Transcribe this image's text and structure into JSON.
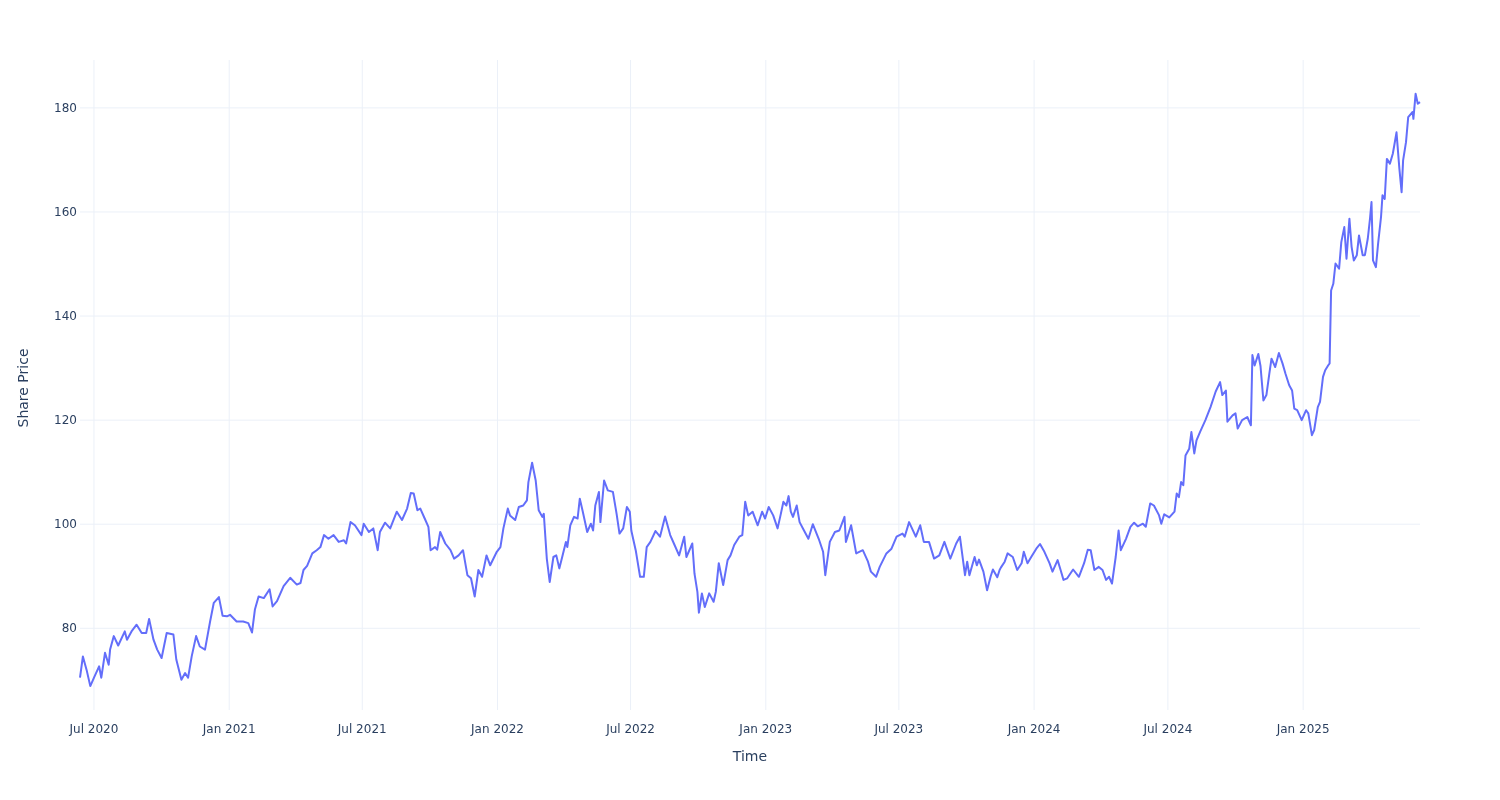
{
  "figure": {
    "chart_data": {
      "type": "line",
      "xlabel": "Time",
      "ylabel": "Share Price",
      "grid": true,
      "xlim": [
        "2020-06-12",
        "2025-06-09"
      ],
      "ylim": [
        64.3,
        189.2
      ],
      "xticks": [
        {
          "value": "2020-07-01",
          "label": "Jul 2020"
        },
        {
          "value": "2021-01-01",
          "label": "Jan 2021"
        },
        {
          "value": "2021-07-01",
          "label": "Jul 2021"
        },
        {
          "value": "2022-01-01",
          "label": "Jan 2022"
        },
        {
          "value": "2022-07-01",
          "label": "Jul 2022"
        },
        {
          "value": "2023-01-01",
          "label": "Jan 2023"
        },
        {
          "value": "2023-07-01",
          "label": "Jul 2023"
        },
        {
          "value": "2024-01-01",
          "label": "Jan 2024"
        },
        {
          "value": "2024-07-01",
          "label": "Jul 2024"
        },
        {
          "value": "2025-01-01",
          "label": "Jan 2025"
        }
      ],
      "yticks": [
        80,
        100,
        120,
        140,
        160,
        180
      ],
      "x": [
        "2020-06-12",
        "2020-06-16",
        "2020-06-21",
        "2020-06-26",
        "2020-07-01",
        "2020-07-08",
        "2020-07-11",
        "2020-07-16",
        "2020-07-21",
        "2020-07-23",
        "2020-07-28",
        "2020-08-03",
        "2020-08-12",
        "2020-08-15",
        "2020-08-21",
        "2020-08-28",
        "2020-09-04",
        "2020-09-10",
        "2020-09-14",
        "2020-09-20",
        "2020-09-25",
        "2020-10-01",
        "2020-10-08",
        "2020-10-17",
        "2020-10-21",
        "2020-10-28",
        "2020-11-02",
        "2020-11-06",
        "2020-11-11",
        "2020-11-17",
        "2020-11-22",
        "2020-11-29",
        "2020-12-06",
        "2020-12-11",
        "2020-12-18",
        "2020-12-23",
        "2020-12-29",
        "2021-01-02",
        "2021-01-11",
        "2021-01-20",
        "2021-01-27",
        "2021-02-01",
        "2021-02-05",
        "2021-02-10",
        "2021-02-17",
        "2021-02-25",
        "2021-03-01",
        "2021-03-07",
        "2021-03-16",
        "2021-03-25",
        "2021-04-03",
        "2021-04-08",
        "2021-04-12",
        "2021-04-17",
        "2021-04-24",
        "2021-04-30",
        "2021-05-05",
        "2021-05-10",
        "2021-05-16",
        "2021-05-23",
        "2021-05-30",
        "2021-06-06",
        "2021-06-09",
        "2021-06-15",
        "2021-06-21",
        "2021-06-30",
        "2021-07-03",
        "2021-07-10",
        "2021-07-16",
        "2021-07-22",
        "2021-07-25",
        "2021-08-01",
        "2021-08-08",
        "2021-08-17",
        "2021-08-24",
        "2021-08-31",
        "2021-09-05",
        "2021-09-09",
        "2021-09-14",
        "2021-09-18",
        "2021-09-24",
        "2021-09-29",
        "2021-10-02",
        "2021-10-08",
        "2021-10-11",
        "2021-10-15",
        "2021-10-22",
        "2021-10-29",
        "2021-11-03",
        "2021-11-09",
        "2021-11-15",
        "2021-11-21",
        "2021-11-26",
        "2021-12-01",
        "2021-12-06",
        "2021-12-11",
        "2021-12-17",
        "2021-12-22",
        "2021-12-31",
        "2022-01-05",
        "2022-01-09",
        "2022-01-15",
        "2022-01-18",
        "2022-01-25",
        "2022-01-30",
        "2022-02-05",
        "2022-02-10",
        "2022-02-12",
        "2022-02-17",
        "2022-02-22",
        "2022-02-26",
        "2022-03-03",
        "2022-03-05",
        "2022-03-09",
        "2022-03-13",
        "2022-03-18",
        "2022-03-22",
        "2022-03-26",
        "2022-03-30",
        "2022-04-04",
        "2022-04-06",
        "2022-04-10",
        "2022-04-15",
        "2022-04-20",
        "2022-04-23",
        "2022-04-27",
        "2022-05-03",
        "2022-05-08",
        "2022-05-11",
        "2022-05-14",
        "2022-05-19",
        "2022-05-21",
        "2022-05-26",
        "2022-05-31",
        "2022-06-07",
        "2022-06-12",
        "2022-06-16",
        "2022-06-21",
        "2022-06-26",
        "2022-06-30",
        "2022-07-02",
        "2022-07-08",
        "2022-07-14",
        "2022-07-19",
        "2022-07-23",
        "2022-07-28",
        "2022-08-04",
        "2022-08-10",
        "2022-08-17",
        "2022-08-24",
        "2022-08-29",
        "2022-09-05",
        "2022-09-12",
        "2022-09-15",
        "2022-09-23",
        "2022-09-26",
        "2022-09-30",
        "2022-10-02",
        "2022-10-06",
        "2022-10-10",
        "2022-10-16",
        "2022-10-22",
        "2022-10-25",
        "2022-10-29",
        "2022-11-04",
        "2022-11-10",
        "2022-11-14",
        "2022-11-19",
        "2022-11-26",
        "2022-11-30",
        "2022-12-04",
        "2022-12-08",
        "2022-12-14",
        "2022-12-21",
        "2022-12-27",
        "2022-12-31",
        "2023-01-05",
        "2023-01-11",
        "2023-01-17",
        "2023-01-21",
        "2023-01-25",
        "2023-01-29",
        "2023-02-01",
        "2023-02-04",
        "2023-02-07",
        "2023-02-12",
        "2023-02-16",
        "2023-02-22",
        "2023-02-28",
        "2023-03-06",
        "2023-03-14",
        "2023-03-20",
        "2023-03-23",
        "2023-03-29",
        "2023-04-05",
        "2023-04-11",
        "2023-04-18",
        "2023-04-20",
        "2023-04-27",
        "2023-05-04",
        "2023-05-13",
        "2023-05-20",
        "2023-05-24",
        "2023-05-31",
        "2023-06-05",
        "2023-06-14",
        "2023-06-21",
        "2023-06-28",
        "2023-07-06",
        "2023-07-09",
        "2023-07-15",
        "2023-07-24",
        "2023-07-30",
        "2023-08-04",
        "2023-08-11",
        "2023-08-18",
        "2023-08-25",
        "2023-09-01",
        "2023-09-09",
        "2023-09-17",
        "2023-09-22",
        "2023-09-29",
        "2023-10-02",
        "2023-10-05",
        "2023-10-12",
        "2023-10-15",
        "2023-10-18",
        "2023-10-24",
        "2023-10-29",
        "2023-11-03",
        "2023-11-06",
        "2023-11-12",
        "2023-11-15",
        "2023-11-17",
        "2023-11-22",
        "2023-11-26",
        "2023-12-03",
        "2023-12-09",
        "2023-12-15",
        "2023-12-18",
        "2023-12-23",
        "2023-12-28",
        "2024-01-04",
        "2024-01-09",
        "2024-01-15",
        "2024-01-22",
        "2024-01-26",
        "2024-02-02",
        "2024-02-06",
        "2024-02-10",
        "2024-02-15",
        "2024-02-23",
        "2024-03-02",
        "2024-03-09",
        "2024-03-14",
        "2024-03-18",
        "2024-03-23",
        "2024-03-29",
        "2024-04-03",
        "2024-04-08",
        "2024-04-12",
        "2024-04-16",
        "2024-04-21",
        "2024-04-25",
        "2024-04-28",
        "2024-05-05",
        "2024-05-11",
        "2024-05-16",
        "2024-05-21",
        "2024-05-28",
        "2024-06-01",
        "2024-06-07",
        "2024-06-12",
        "2024-06-19",
        "2024-06-22",
        "2024-06-26",
        "2024-07-03",
        "2024-07-10",
        "2024-07-13",
        "2024-07-16",
        "2024-07-19",
        "2024-07-22",
        "2024-07-25",
        "2024-07-30",
        "2024-08-02",
        "2024-08-06",
        "2024-08-09",
        "2024-08-14",
        "2024-08-21",
        "2024-08-28",
        "2024-09-04",
        "2024-09-10",
        "2024-09-13",
        "2024-09-18",
        "2024-09-20",
        "2024-09-27",
        "2024-10-01",
        "2024-10-04",
        "2024-10-10",
        "2024-10-17",
        "2024-10-22",
        "2024-10-24",
        "2024-10-27",
        "2024-11-01",
        "2024-11-04",
        "2024-11-08",
        "2024-11-12",
        "2024-11-16",
        "2024-11-19",
        "2024-11-24",
        "2024-11-29",
        "2024-12-04",
        "2024-12-08",
        "2024-12-13",
        "2024-12-17",
        "2024-12-20",
        "2024-12-24",
        "2024-12-30",
        "2025-01-05",
        "2025-01-08",
        "2025-01-13",
        "2025-01-16",
        "2025-01-21",
        "2025-01-24",
        "2025-01-28",
        "2025-01-31",
        "2025-02-04",
        "2025-02-06",
        "2025-02-08",
        "2025-02-11",
        "2025-02-14",
        "2025-02-19",
        "2025-02-22",
        "2025-02-26",
        "2025-03-01",
        "2025-03-05",
        "2025-03-08",
        "2025-03-11",
        "2025-03-15",
        "2025-03-18",
        "2025-03-23",
        "2025-03-26",
        "2025-03-30",
        "2025-04-02",
        "2025-04-04",
        "2025-04-06",
        "2025-04-10",
        "2025-04-13",
        "2025-04-17",
        "2025-04-19",
        "2025-04-22",
        "2025-04-25",
        "2025-04-29",
        "2025-05-03",
        "2025-05-05",
        "2025-05-08",
        "2025-05-12",
        "2025-05-15",
        "2025-05-17",
        "2025-05-21",
        "2025-05-24",
        "2025-05-30",
        "2025-05-31",
        "2025-06-03",
        "2025-06-06",
        "2025-06-09"
      ],
      "series": [
        {
          "color": "#636efa",
          "values": [
            70.5,
            74.6,
            72,
            68.9,
            70.5,
            72.7,
            70.5,
            75.3,
            73,
            75.9,
            78.5,
            76.7,
            79.4,
            77.8,
            79.4,
            80.7,
            79.1,
            79.1,
            81.8,
            77.8,
            75.9,
            74.3,
            79.1,
            78.8,
            74,
            70.1,
            71.4,
            70.5,
            74.6,
            78.5,
            76.5,
            75.9,
            81.3,
            84.9,
            86,
            82.4,
            82.3,
            82.6,
            81.3,
            81.3,
            81,
            79.2,
            83.6,
            86.1,
            85.8,
            87.5,
            84.2,
            85.2,
            88.1,
            89.7,
            88.4,
            88.7,
            91.2,
            92,
            94.4,
            95,
            95.6,
            97.9,
            97.2,
            97.9,
            96.6,
            96.9,
            96.3,
            100.4,
            99.8,
            97.9,
            100.1,
            98.5,
            99.2,
            95,
            98.5,
            100.3,
            99.2,
            102.4,
            100.8,
            103,
            106,
            105.9,
            102.7,
            103,
            101.1,
            99.5,
            95,
            95.6,
            95.1,
            98.5,
            96.3,
            95,
            93.4,
            94,
            95,
            90.2,
            89.6,
            86.1,
            91.2,
            89.9,
            94,
            92.1,
            94.7,
            95.6,
            99.2,
            103,
            101.7,
            100.8,
            103.3,
            103.6,
            104.6,
            108.1,
            111.8,
            108.4,
            102.7,
            101.4,
            102,
            93.4,
            88.9,
            93.7,
            94,
            91.5,
            93.7,
            96.6,
            95.6,
            99.8,
            101.4,
            101.1,
            104.9,
            102.4,
            98.5,
            100.1,
            98.8,
            103.6,
            106.2,
            100.4,
            108.4,
            106.5,
            106.2,
            102,
            98.2,
            99.2,
            103.3,
            102.4,
            98.8,
            95,
            89.9,
            89.9,
            95.6,
            96.6,
            98.7,
            97.6,
            101.5,
            97.9,
            96.3,
            94,
            97.6,
            93.7,
            96.3,
            90.5,
            87,
            83,
            86.7,
            84.1,
            86.7,
            85.1,
            87,
            92.5,
            88.3,
            93.1,
            94,
            96,
            97.6,
            97.9,
            104.3,
            101.7,
            102.4,
            99.8,
            102.4,
            101.1,
            103.3,
            101.7,
            99.2,
            101.7,
            104.3,
            103.6,
            105.4,
            102.4,
            101.4,
            103.6,
            100.4,
            98.8,
            97.2,
            100,
            97.2,
            94.7,
            90.2,
            96.6,
            98.5,
            98.8,
            101.4,
            96.6,
            99.8,
            94.4,
            95,
            92.8,
            90.9,
            89.9,
            91.8,
            94.4,
            95.3,
            97.6,
            98.2,
            97.6,
            100.4,
            97.6,
            99.8,
            96.6,
            96.6,
            93.4,
            94,
            96.6,
            93.4,
            96.3,
            97.6,
            90.2,
            92.8,
            90.2,
            93.7,
            92.1,
            93.2,
            90.9,
            87.3,
            90,
            91.3,
            89.8,
            91.2,
            91.7,
            92.8,
            94.4,
            93.7,
            91.2,
            92.5,
            94.7,
            92.5,
            93.7,
            95.3,
            96.2,
            94.7,
            92.5,
            90.9,
            93.1,
            91.2,
            89.3,
            89.6,
            91.3,
            89.9,
            92.5,
            95.1,
            95,
            91.2,
            91.8,
            91.2,
            89.3,
            89.9,
            88.6,
            93.7,
            98.8,
            95,
            97.2,
            99.5,
            100.3,
            99.6,
            100.1,
            99.5,
            104,
            103.6,
            101.7,
            100.1,
            101.9,
            101.3,
            102.4,
            105.9,
            105.2,
            108.1,
            107.5,
            113.2,
            114.5,
            117.7,
            113.6,
            116.1,
            117.8,
            120,
            122.5,
            125.5,
            127.3,
            124.8,
            125.7,
            119.7,
            120.9,
            121.3,
            118.4,
            120,
            120.6,
            119,
            132.5,
            130.5,
            132.7,
            130.4,
            123.8,
            124.8,
            128.9,
            131.8,
            130.2,
            132.9,
            130.9,
            128.9,
            126.7,
            125.7,
            122.2,
            121.9,
            120,
            121.9,
            121.3,
            117.1,
            118.1,
            122.5,
            123.5,
            128.3,
            129.6,
            130.5,
            130.9,
            144.9,
            146.2,
            150.1,
            149.1,
            154.2,
            157.1,
            151,
            158.7,
            153.3,
            150.7,
            151.7,
            155.5,
            151.7,
            151.7,
            154.9,
            158.7,
            161.9,
            150.7,
            149.4,
            153.9,
            159,
            163.2,
            162.5,
            170.2,
            169.3,
            171.2,
            172.8,
            175.3,
            168.3,
            163.8,
            169.9,
            173.4,
            178.2,
            179.2,
            177.9,
            182.7,
            180.8,
            181.1
          ]
        }
      ]
    }
  }
}
